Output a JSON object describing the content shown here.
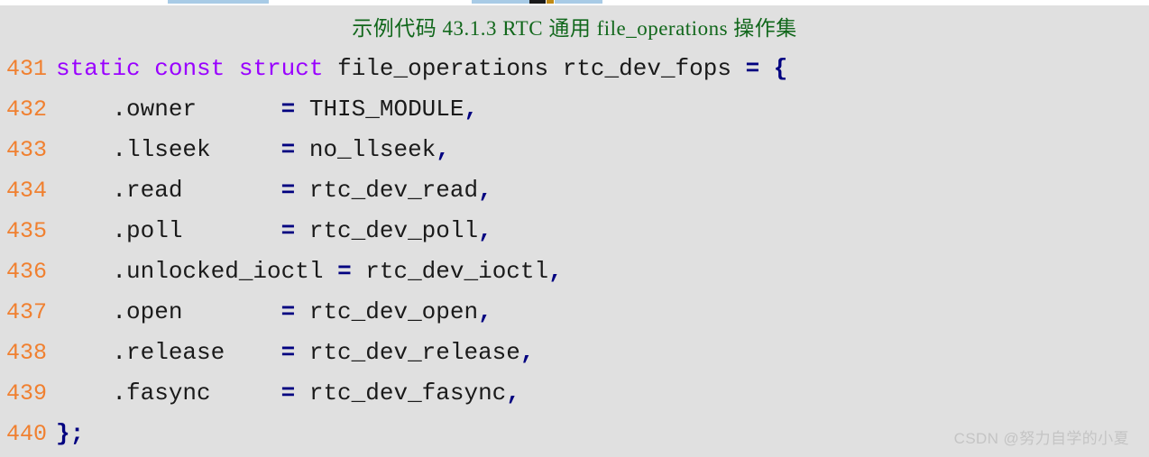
{
  "page": {
    "background_color": "#ffffff",
    "code_background_color": "#e0e0e0"
  },
  "listing": {
    "title": "示例代码 43.1.3 RTC 通用  file_operations 操作集",
    "title_color": "#11671b",
    "language": "c",
    "first_line_number": 431,
    "last_line_number": 440,
    "colors": {
      "line_number": "#f08030",
      "keyword": "#9900ff",
      "identifier": "#1a1a1a",
      "operator": "#000080",
      "punctuation": "#000080"
    },
    "lines": [
      {
        "number": "431",
        "tokens": [
          {
            "text": "static",
            "kind": "keyword"
          },
          {
            "text": " ",
            "kind": "plain"
          },
          {
            "text": "const",
            "kind": "keyword"
          },
          {
            "text": " ",
            "kind": "plain"
          },
          {
            "text": "struct",
            "kind": "keyword"
          },
          {
            "text": " file_operations rtc_dev_fops ",
            "kind": "identifier"
          },
          {
            "text": "=",
            "kind": "operator"
          },
          {
            "text": " ",
            "kind": "plain"
          },
          {
            "text": "{",
            "kind": "punctuation"
          }
        ]
      },
      {
        "number": "432",
        "tokens": [
          {
            "text": "    .owner      ",
            "kind": "identifier"
          },
          {
            "text": "=",
            "kind": "operator"
          },
          {
            "text": " THIS_MODULE",
            "kind": "identifier"
          },
          {
            "text": ",",
            "kind": "punctuation"
          }
        ]
      },
      {
        "number": "433",
        "tokens": [
          {
            "text": "    .llseek     ",
            "kind": "identifier"
          },
          {
            "text": "=",
            "kind": "operator"
          },
          {
            "text": " no_llseek",
            "kind": "identifier"
          },
          {
            "text": ",",
            "kind": "punctuation"
          }
        ]
      },
      {
        "number": "434",
        "tokens": [
          {
            "text": "    .read       ",
            "kind": "identifier"
          },
          {
            "text": "=",
            "kind": "operator"
          },
          {
            "text": " rtc_dev_read",
            "kind": "identifier"
          },
          {
            "text": ",",
            "kind": "punctuation"
          }
        ]
      },
      {
        "number": "435",
        "tokens": [
          {
            "text": "    .poll       ",
            "kind": "identifier"
          },
          {
            "text": "=",
            "kind": "operator"
          },
          {
            "text": " rtc_dev_poll",
            "kind": "identifier"
          },
          {
            "text": ",",
            "kind": "punctuation"
          }
        ]
      },
      {
        "number": "436",
        "tokens": [
          {
            "text": "    .unlocked_ioctl ",
            "kind": "identifier"
          },
          {
            "text": "=",
            "kind": "operator"
          },
          {
            "text": " rtc_dev_ioctl",
            "kind": "identifier"
          },
          {
            "text": ",",
            "kind": "punctuation"
          }
        ]
      },
      {
        "number": "437",
        "tokens": [
          {
            "text": "    .open       ",
            "kind": "identifier"
          },
          {
            "text": "=",
            "kind": "operator"
          },
          {
            "text": " rtc_dev_open",
            "kind": "identifier"
          },
          {
            "text": ",",
            "kind": "punctuation"
          }
        ]
      },
      {
        "number": "438",
        "tokens": [
          {
            "text": "    .release    ",
            "kind": "identifier"
          },
          {
            "text": "=",
            "kind": "operator"
          },
          {
            "text": " rtc_dev_release",
            "kind": "identifier"
          },
          {
            "text": ",",
            "kind": "punctuation"
          }
        ]
      },
      {
        "number": "439",
        "tokens": [
          {
            "text": "    .fasync     ",
            "kind": "identifier"
          },
          {
            "text": "=",
            "kind": "operator"
          },
          {
            "text": " rtc_dev_fasync",
            "kind": "identifier"
          },
          {
            "text": ",",
            "kind": "punctuation"
          }
        ]
      },
      {
        "number": "440",
        "tokens": [
          {
            "text": "};",
            "kind": "punctuation"
          }
        ]
      }
    ]
  },
  "watermark": {
    "text": "CSDN @努力自学的小夏",
    "color": "#c4c4c4"
  }
}
